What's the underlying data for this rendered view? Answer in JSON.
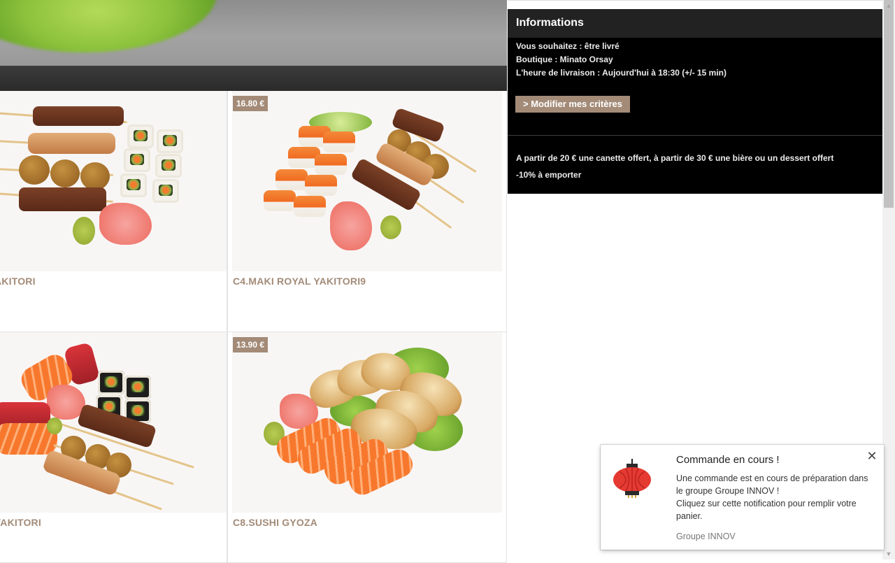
{
  "products": [
    {
      "name": "AKITORI",
      "price": ""
    },
    {
      "name": "C4.MAKI ROYAL YAKITORI9",
      "price": "16.80 €"
    },
    {
      "name": "YAKITORI",
      "price": ""
    },
    {
      "name": "C8.SUSHI GYOZA",
      "price": "13.90 €"
    }
  ],
  "info_panel": {
    "title": "Informations",
    "delivery_mode": "Vous souhaitez : être livré",
    "shop": "Boutique : Minato Orsay",
    "delivery_time": "L'heure de livraison : Aujourd'hui à 18:30 (+/- 15 min)",
    "modify_button": "> Modifier mes critères",
    "promo_1": "A partir de 20 € une canette offert, à partir de 30 € une bière ou un dessert offert",
    "promo_2": "-10% à emporter"
  },
  "notification": {
    "title": "Commande en cours !",
    "body_line_1": "Une commande est en cours de préparation dans le groupe Groupe INNOV !",
    "body_line_2": "Cliquez sur cette notification pour remplir votre panier.",
    "source": "Groupe INNOV",
    "close_symbol": "✕",
    "icon": "lantern-icon"
  },
  "scrollbar": {
    "up_arrow": "▲",
    "down_arrow": "▼"
  },
  "colors": {
    "accent": "#a38b78",
    "panel": "#000000",
    "panel_header": "#222222"
  }
}
